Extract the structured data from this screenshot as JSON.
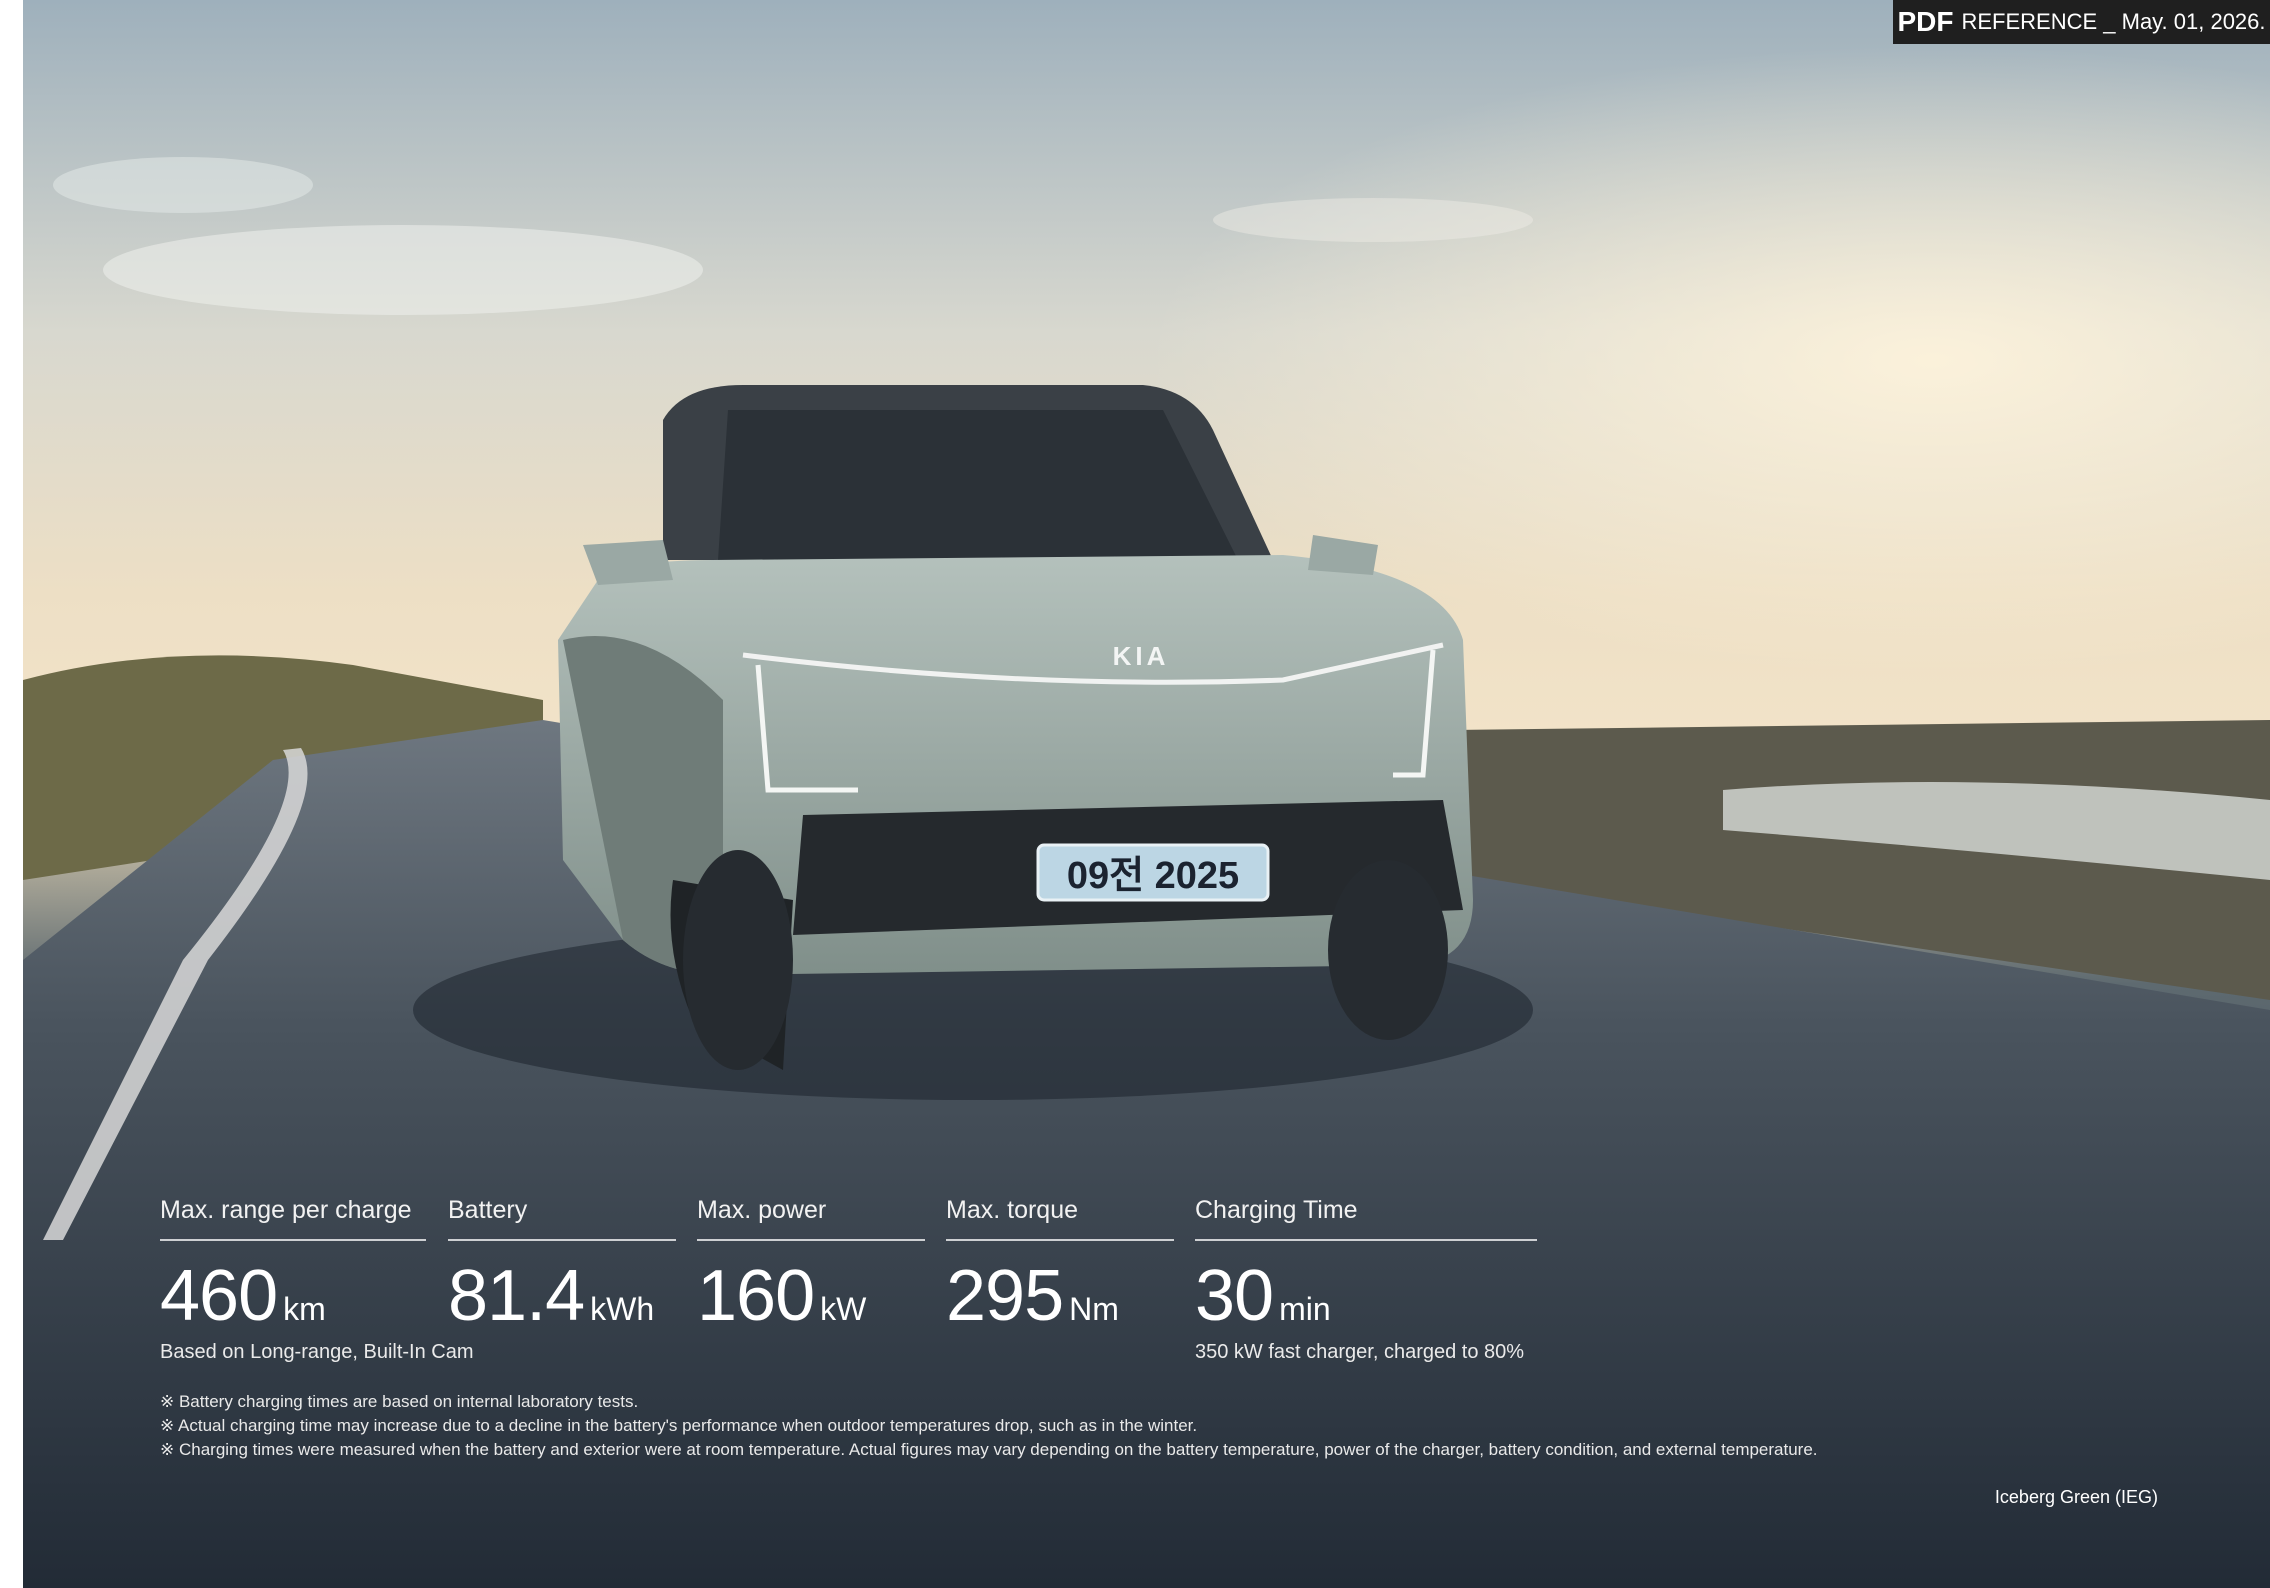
{
  "header": {
    "badge_pdf": "PDF",
    "badge_text": "REFERENCE _ May. 01, 2026."
  },
  "vehicle": {
    "brand_logo_text": "KIA",
    "plate_text": "09전 2025"
  },
  "specs": [
    {
      "label": "Max. range per charge",
      "value": "460",
      "unit": "km",
      "note": "Based on Long-range, Built-In Cam"
    },
    {
      "label": "Battery",
      "value": "81.4",
      "unit": "kWh",
      "note": ""
    },
    {
      "label": "Max. power",
      "value": "160",
      "unit": "kW",
      "note": ""
    },
    {
      "label": "Max. torque",
      "value": "295",
      "unit": "Nm",
      "note": ""
    },
    {
      "label": "Charging Time",
      "value": "30",
      "unit": "min",
      "note": "350 kW fast charger, charged to 80%"
    }
  ],
  "notes": [
    "※ Battery charging times are based on internal laboratory tests.",
    "※ Actual charging time may increase due to a decline in the battery's performance when outdoor temperatures drop, such as in the winter.",
    "※ Charging times were measured when the battery and exterior were at room temperature. Actual figures may vary depending on the battery temperature, power of the charger, battery condition, and external temperature."
  ],
  "caption": "Iceberg Green (IEG)",
  "colors": {
    "badge_bg": "#1f1f1f",
    "car_body": "#9aa8a2",
    "text": "#ffffff"
  }
}
